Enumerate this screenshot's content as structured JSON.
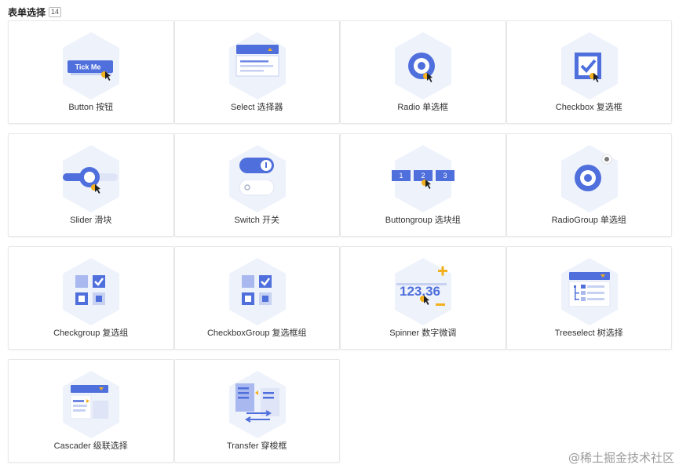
{
  "header": {
    "title": "表单选择",
    "count": "14"
  },
  "cards": [
    {
      "label": "Button 按钮",
      "icon": "button-icon",
      "icon_text": "Tick Me"
    },
    {
      "label": "Select 选择器",
      "icon": "select-icon"
    },
    {
      "label": "Radio 单选框",
      "icon": "radio-icon"
    },
    {
      "label": "Checkbox 复选框",
      "icon": "checkbox-icon"
    },
    {
      "label": "Slider 滑块",
      "icon": "slider-icon"
    },
    {
      "label": "Switch 开关",
      "icon": "switch-icon"
    },
    {
      "label": "Buttongroup 选块组",
      "icon": "buttongroup-icon",
      "icon_text": [
        "1",
        "2",
        "3"
      ]
    },
    {
      "label": "RadioGroup 单选组",
      "icon": "radiogroup-icon"
    },
    {
      "label": "Checkgroup 复选组",
      "icon": "checkgroup-icon"
    },
    {
      "label": "CheckboxGroup 复选框组",
      "icon": "checkboxgroup-icon"
    },
    {
      "label": "Spinner 数字微调",
      "icon": "spinner-icon",
      "icon_text": "123.36"
    },
    {
      "label": "Treeselect 树选择",
      "icon": "treeselect-icon"
    },
    {
      "label": "Cascader 级联选择",
      "icon": "cascader-icon"
    },
    {
      "label": "Transfer 穿梭框",
      "icon": "transfer-icon"
    }
  ],
  "watermark": "@稀土掘金技术社区",
  "colors": {
    "primary": "#4f6fdc",
    "accent": "#f2b01e",
    "hex_bg": "#eef2fb"
  }
}
